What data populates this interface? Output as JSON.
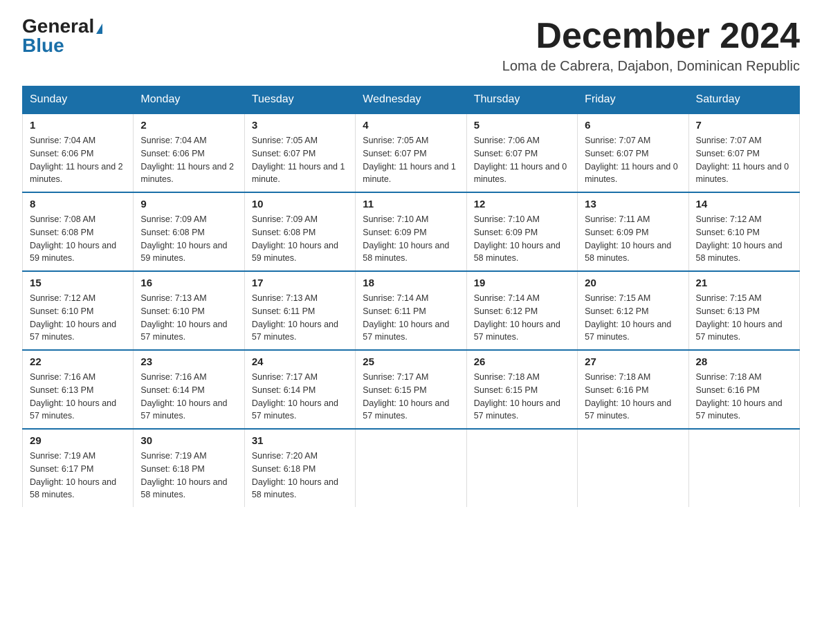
{
  "header": {
    "logo_general": "General",
    "logo_blue": "Blue",
    "month_title": "December 2024",
    "location": "Loma de Cabrera, Dajabon, Dominican Republic"
  },
  "days_of_week": [
    "Sunday",
    "Monday",
    "Tuesday",
    "Wednesday",
    "Thursday",
    "Friday",
    "Saturday"
  ],
  "weeks": [
    [
      {
        "num": "1",
        "sunrise": "7:04 AM",
        "sunset": "6:06 PM",
        "daylight": "11 hours and 2 minutes."
      },
      {
        "num": "2",
        "sunrise": "7:04 AM",
        "sunset": "6:06 PM",
        "daylight": "11 hours and 2 minutes."
      },
      {
        "num": "3",
        "sunrise": "7:05 AM",
        "sunset": "6:07 PM",
        "daylight": "11 hours and 1 minute."
      },
      {
        "num": "4",
        "sunrise": "7:05 AM",
        "sunset": "6:07 PM",
        "daylight": "11 hours and 1 minute."
      },
      {
        "num": "5",
        "sunrise": "7:06 AM",
        "sunset": "6:07 PM",
        "daylight": "11 hours and 0 minutes."
      },
      {
        "num": "6",
        "sunrise": "7:07 AM",
        "sunset": "6:07 PM",
        "daylight": "11 hours and 0 minutes."
      },
      {
        "num": "7",
        "sunrise": "7:07 AM",
        "sunset": "6:07 PM",
        "daylight": "11 hours and 0 minutes."
      }
    ],
    [
      {
        "num": "8",
        "sunrise": "7:08 AM",
        "sunset": "6:08 PM",
        "daylight": "10 hours and 59 minutes."
      },
      {
        "num": "9",
        "sunrise": "7:09 AM",
        "sunset": "6:08 PM",
        "daylight": "10 hours and 59 minutes."
      },
      {
        "num": "10",
        "sunrise": "7:09 AM",
        "sunset": "6:08 PM",
        "daylight": "10 hours and 59 minutes."
      },
      {
        "num": "11",
        "sunrise": "7:10 AM",
        "sunset": "6:09 PM",
        "daylight": "10 hours and 58 minutes."
      },
      {
        "num": "12",
        "sunrise": "7:10 AM",
        "sunset": "6:09 PM",
        "daylight": "10 hours and 58 minutes."
      },
      {
        "num": "13",
        "sunrise": "7:11 AM",
        "sunset": "6:09 PM",
        "daylight": "10 hours and 58 minutes."
      },
      {
        "num": "14",
        "sunrise": "7:12 AM",
        "sunset": "6:10 PM",
        "daylight": "10 hours and 58 minutes."
      }
    ],
    [
      {
        "num": "15",
        "sunrise": "7:12 AM",
        "sunset": "6:10 PM",
        "daylight": "10 hours and 57 minutes."
      },
      {
        "num": "16",
        "sunrise": "7:13 AM",
        "sunset": "6:10 PM",
        "daylight": "10 hours and 57 minutes."
      },
      {
        "num": "17",
        "sunrise": "7:13 AM",
        "sunset": "6:11 PM",
        "daylight": "10 hours and 57 minutes."
      },
      {
        "num": "18",
        "sunrise": "7:14 AM",
        "sunset": "6:11 PM",
        "daylight": "10 hours and 57 minutes."
      },
      {
        "num": "19",
        "sunrise": "7:14 AM",
        "sunset": "6:12 PM",
        "daylight": "10 hours and 57 minutes."
      },
      {
        "num": "20",
        "sunrise": "7:15 AM",
        "sunset": "6:12 PM",
        "daylight": "10 hours and 57 minutes."
      },
      {
        "num": "21",
        "sunrise": "7:15 AM",
        "sunset": "6:13 PM",
        "daylight": "10 hours and 57 minutes."
      }
    ],
    [
      {
        "num": "22",
        "sunrise": "7:16 AM",
        "sunset": "6:13 PM",
        "daylight": "10 hours and 57 minutes."
      },
      {
        "num": "23",
        "sunrise": "7:16 AM",
        "sunset": "6:14 PM",
        "daylight": "10 hours and 57 minutes."
      },
      {
        "num": "24",
        "sunrise": "7:17 AM",
        "sunset": "6:14 PM",
        "daylight": "10 hours and 57 minutes."
      },
      {
        "num": "25",
        "sunrise": "7:17 AM",
        "sunset": "6:15 PM",
        "daylight": "10 hours and 57 minutes."
      },
      {
        "num": "26",
        "sunrise": "7:18 AM",
        "sunset": "6:15 PM",
        "daylight": "10 hours and 57 minutes."
      },
      {
        "num": "27",
        "sunrise": "7:18 AM",
        "sunset": "6:16 PM",
        "daylight": "10 hours and 57 minutes."
      },
      {
        "num": "28",
        "sunrise": "7:18 AM",
        "sunset": "6:16 PM",
        "daylight": "10 hours and 57 minutes."
      }
    ],
    [
      {
        "num": "29",
        "sunrise": "7:19 AM",
        "sunset": "6:17 PM",
        "daylight": "10 hours and 58 minutes."
      },
      {
        "num": "30",
        "sunrise": "7:19 AM",
        "sunset": "6:18 PM",
        "daylight": "10 hours and 58 minutes."
      },
      {
        "num": "31",
        "sunrise": "7:20 AM",
        "sunset": "6:18 PM",
        "daylight": "10 hours and 58 minutes."
      },
      null,
      null,
      null,
      null
    ]
  ],
  "labels": {
    "sunrise": "Sunrise:",
    "sunset": "Sunset:",
    "daylight": "Daylight:"
  }
}
